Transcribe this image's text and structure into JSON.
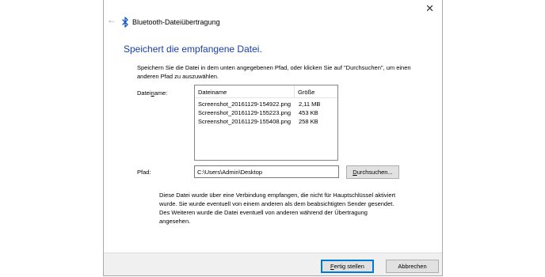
{
  "window": {
    "title": "Bluetooth-Dateiübertragung",
    "back_icon": "back-arrow-icon",
    "app_icon": "bluetooth-icon",
    "close_icon": "close-icon"
  },
  "heading": "Speichert die empfangene Datei.",
  "instructions": "Speichern Sie die Datei in dem unten angegebenen Pfad, oder klicken Sie auf \"Durchsuchen\", um einen anderen Pfad zu auszuwählen.",
  "filename": {
    "label_pre": "Datei",
    "label_access": "n",
    "label_post": "ame:",
    "columns": {
      "name": "Dateiname",
      "size": "Größe"
    },
    "rows": [
      {
        "name": "Screenshot_20161129-154922.png",
        "size": "2,11 MB"
      },
      {
        "name": "Screenshot_20161129-155223.png",
        "size": "453 KB"
      },
      {
        "name": "Screenshot_20161129-155408.png",
        "size": "258 KB"
      }
    ]
  },
  "path": {
    "label": "Pfad:",
    "value": "C:\\Users\\Admin\\Desktop",
    "browse_access": "D",
    "browse_rest": "urchsuchen..."
  },
  "notice": "Diese Datei wurde über eine Verbindung empfangen, die nicht für Hauptschlüssel aktiviert wurde. Sie wurde eventuell von einem anderen als dem beabsichtigten Sender gesendet. Des Weiteren wurde die Datei eventuell von anderen während der Übertragung angesehen.",
  "footer": {
    "finish_access": "F",
    "finish_rest": "ertig stellen",
    "cancel": "Abbrechen"
  },
  "colors": {
    "heading": "#1a3ea8",
    "default_button_border": "#0078d7",
    "footer_bg": "#f0f0f0"
  }
}
